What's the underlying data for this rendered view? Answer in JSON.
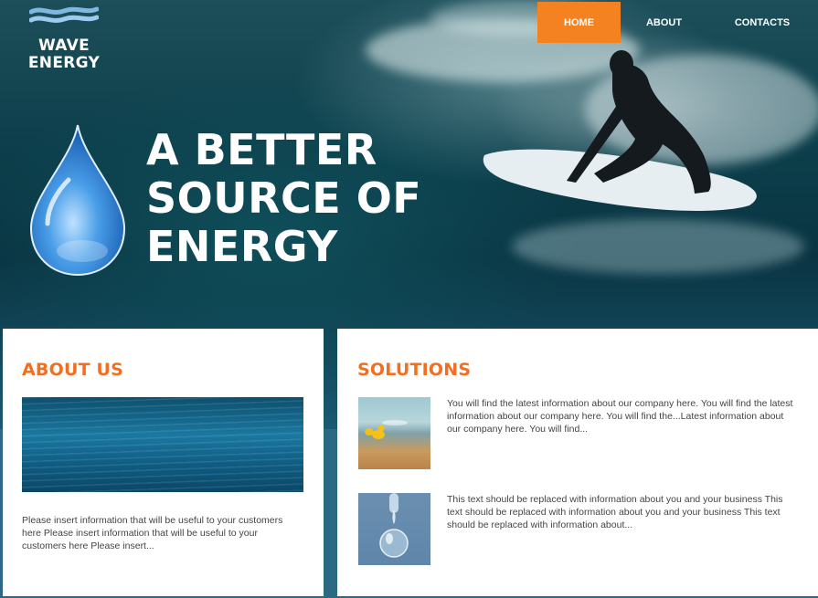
{
  "logo": {
    "line1": "WAVE",
    "line2": "ENERGY",
    "icon": "wave-logo-icon"
  },
  "nav": {
    "home": "HOME",
    "about": "ABOUT",
    "contacts": "CONTACTS",
    "active": "home"
  },
  "hero": {
    "headline": [
      "A BETTER",
      "SOURCE OF",
      "ENERGY"
    ],
    "icon": "water-drop-icon"
  },
  "about": {
    "title": "ABOUT US",
    "text": "Please insert information that will be useful to your customers here Please insert information that will be useful to your customers here Please insert..."
  },
  "solutions": {
    "title": "SOLUTIONS",
    "items": [
      {
        "text": "You will find the latest information about our company here. You will find the latest information about our company here. You will find the...Latest information about our company here. You will find..."
      },
      {
        "text": "This text should be replaced with information about you and your business This text should be replaced with information about you and your business This text should be replaced with information about..."
      }
    ]
  },
  "colors": {
    "accent": "#f58220",
    "title": "#f26f21",
    "background": "#2b6a82"
  }
}
